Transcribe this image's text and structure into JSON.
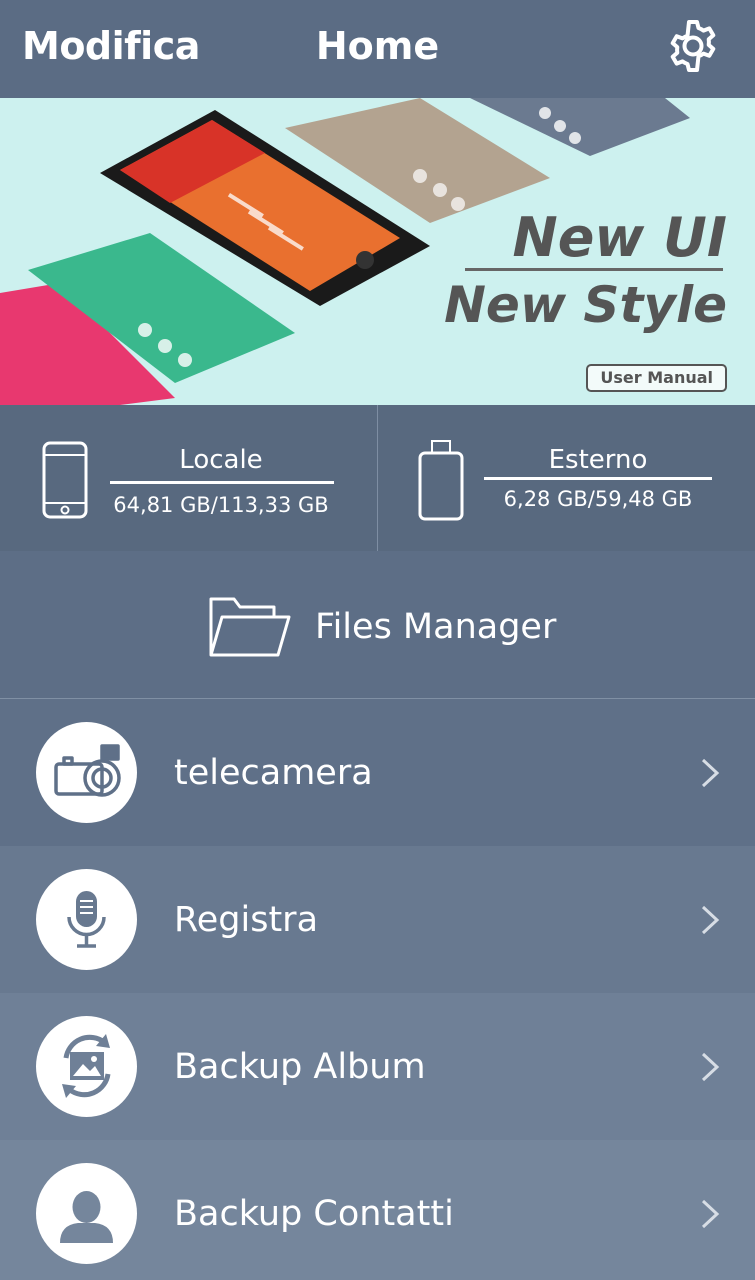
{
  "header": {
    "left_label": "Modifica",
    "title": "Home",
    "settings_icon": "gear-icon"
  },
  "banner": {
    "headline_1": "New UI",
    "headline_2": "New Style",
    "manual_button": "User Manual"
  },
  "storage": {
    "local": {
      "label": "Locale",
      "value": "64,81 GB/113,33 GB",
      "icon": "phone-icon"
    },
    "external": {
      "label": "Esterno",
      "value": "6,28 GB/59,48 GB",
      "icon": "usb-drive-icon"
    }
  },
  "files_manager": {
    "label": "Files Manager",
    "icon": "folder-icon"
  },
  "menu": [
    {
      "label": "telecamera",
      "icon": "camera-icon"
    },
    {
      "label": "Registra",
      "icon": "microphone-icon"
    },
    {
      "label": "Backup Album",
      "icon": "photo-sync-icon"
    },
    {
      "label": "Backup Contatti",
      "icon": "contact-icon"
    }
  ],
  "colors": {
    "header": "#5b6c84",
    "banner_bg": "#cdf1ef",
    "row_1": "#5f7088",
    "row_2": "#687990",
    "row_3": "#6f8097",
    "row_4": "#75869c"
  }
}
